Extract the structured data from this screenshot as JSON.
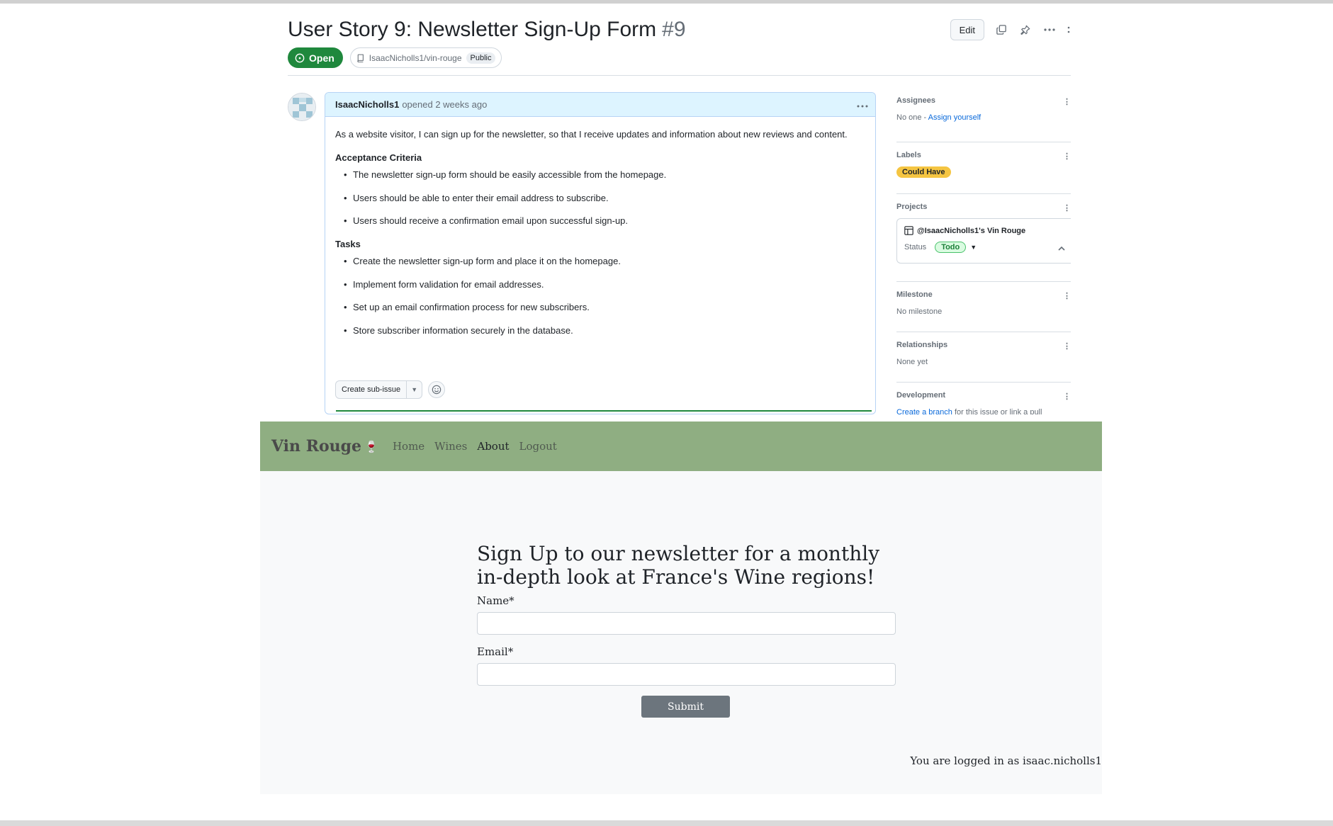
{
  "issue": {
    "title": "User Story 9: Newsletter Sign-Up Form",
    "number": "#9",
    "state_label": "Open",
    "repo": "IsaacNicholls1/vin-rouge",
    "visibility": "Public",
    "edit_label": "Edit",
    "icons": [
      "copy-icon",
      "pin-icon",
      "kebab-icon",
      "more-icon"
    ]
  },
  "comment": {
    "author": "IsaacNicholls1",
    "opened": "opened 2 weeks ago",
    "intro": "As a website visitor, I can sign up for the newsletter, so that I receive updates and information about new reviews and content.",
    "criteria_heading": "Acceptance Criteria",
    "criteria": [
      "The newsletter sign-up form should be easily accessible from the homepage.",
      "Users should be able to enter their email address to subscribe.",
      "Users should receive a confirmation email upon successful sign-up."
    ],
    "tasks_heading": "Tasks",
    "tasks": [
      "Create the newsletter sign-up form and place it on the homepage.",
      "Implement form validation for email addresses.",
      "Set up an email confirmation process for new subscribers.",
      "Store subscriber information securely in the database."
    ],
    "sub_issue_label": "Create sub-issue"
  },
  "sidebar": {
    "assignees": {
      "heading": "Assignees",
      "value_prefix": "No one - ",
      "link": "Assign yourself"
    },
    "labels": {
      "heading": "Labels",
      "label": "Could Have",
      "label_color": "#f5c542"
    },
    "projects": {
      "heading": "Projects",
      "project": "@IsaacNicholls1's Vin Rouge",
      "status_label": "Status",
      "status": "Todo"
    },
    "milestone": {
      "heading": "Milestone",
      "value": "No milestone"
    },
    "relationships": {
      "heading": "Relationships",
      "value": "None yet"
    },
    "development": {
      "heading": "Development",
      "link": "Create a branch",
      "value_suffix": " for this issue or link a pull"
    }
  },
  "site": {
    "brand": "Vin Rouge",
    "brand_icon": "wine-glass-icon",
    "nav": [
      "Home",
      "Wines",
      "About",
      "Logout"
    ],
    "active_nav": "About",
    "nav_color": "#8fae82",
    "heading": "Sign Up to our newsletter for a monthly in-depth look at France's Wine regions!",
    "name_label": "Name*",
    "email_label": "Email*",
    "submit_label": "Submit",
    "logged_in": "You are logged in as isaac.nicholls1"
  }
}
